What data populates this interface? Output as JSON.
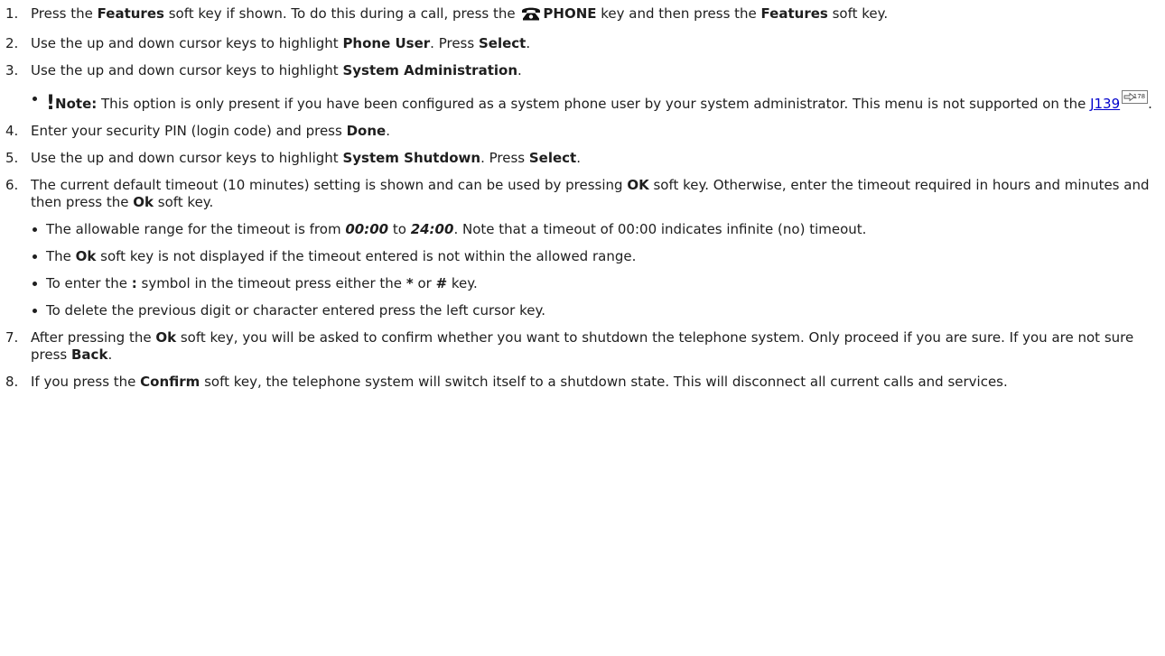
{
  "steps": [
    {
      "num": "1.",
      "t1": "Press the ",
      "b1": "Features",
      "t2": " soft key if shown. To do this during a call, press the ",
      "b2": "PHONE",
      "t3": " key and then press the ",
      "b3": "Features",
      "t4": " soft key."
    },
    {
      "num": "2.",
      "t1": "Use the up and down cursor keys to highlight ",
      "b1": "Phone User",
      "t2": ". Press ",
      "b2": "Select",
      "t3": "."
    },
    {
      "num": "3.",
      "t1": "Use the up and down cursor keys to highlight ",
      "b1": "System Administration",
      "t2": ".",
      "note": {
        "mark": "!",
        "label": "Note:",
        "t1": " This option is only present if you have been configured as a system phone user by your system administrator. This menu is not supported on the ",
        "link": "J139",
        "ref": "178",
        "t2": "."
      }
    },
    {
      "num": "4.",
      "t1": "Enter your security PIN (login code) and press ",
      "b1": "Done",
      "t2": "."
    },
    {
      "num": "5.",
      "t1": "Use the up and down cursor keys to highlight ",
      "b1": "System Shutdown",
      "t2": ". Press ",
      "b2": "Select",
      "t3": "."
    },
    {
      "num": "6.",
      "t1": "The current default timeout (10 minutes) setting is shown and can be used by pressing ",
      "b1": "OK",
      "t2": " soft key. Otherwise, enter the timeout required in hours and minutes and then press the ",
      "b2": "Ok",
      "t3": " soft key.",
      "bullets": [
        {
          "t1": "The allowable range for the timeout is from ",
          "bi1": "00:00",
          "t2": " to ",
          "bi2": "24:00",
          "t3": ". Note that a timeout of 00:00 indicates infinite (no) timeout."
        },
        {
          "t1": "The ",
          "b1": "Ok",
          "t2": " soft key is not displayed if the timeout entered is not within the allowed range."
        },
        {
          "t1": "To enter the ",
          "b1": ":",
          "t2": " symbol in the timeout press either the ",
          "b2": "*",
          "t3": " or ",
          "b3": "#",
          "t4": " key."
        },
        {
          "t1": "To delete the previous digit or character entered press the left cursor key."
        }
      ]
    },
    {
      "num": "7.",
      "t1": "After pressing the ",
      "b1": "Ok",
      "t2": " soft key, you will be asked to confirm whether you want to shutdown the telephone system. Only proceed if you are sure. If you are not sure press ",
      "b2": "Back",
      "t3": "."
    },
    {
      "num": "8.",
      "t1": "If you press the ",
      "b1": "Confirm",
      "t2": " soft key, the telephone system will switch itself to a shutdown state. This will disconnect all current calls and services."
    }
  ]
}
